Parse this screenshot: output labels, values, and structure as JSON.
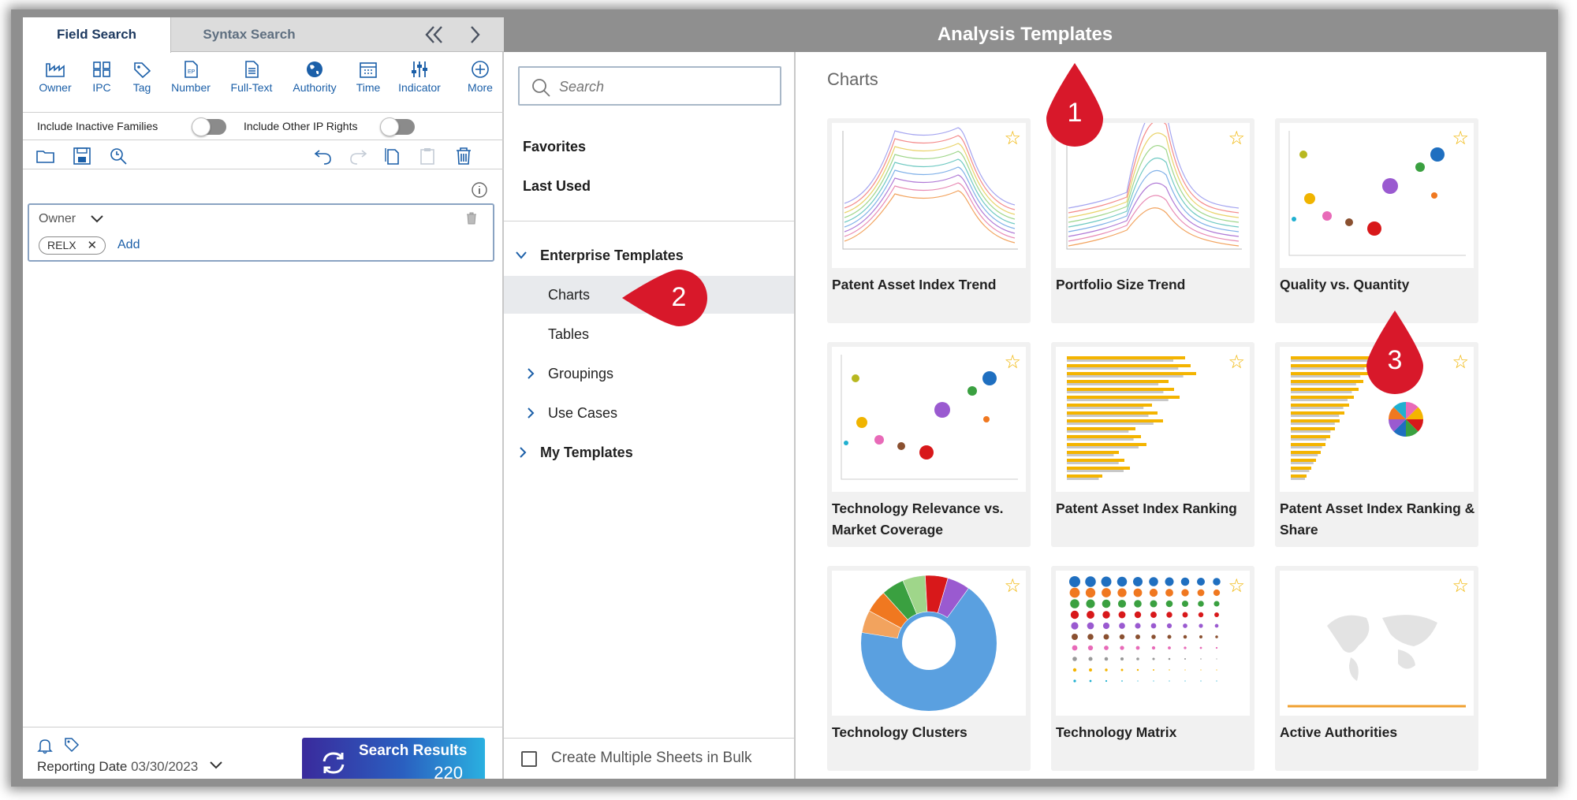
{
  "left": {
    "tabs": {
      "field_search": "Field Search",
      "syntax_search": "Syntax Search"
    },
    "tools": [
      "Owner",
      "IPC",
      "Tag",
      "Number",
      "Full-Text",
      "Authority",
      "Time",
      "Indicator",
      "More"
    ],
    "toggles": {
      "inactive": "Include Inactive Families",
      "other_ip": "Include Other IP Rights"
    },
    "owner_field": {
      "label": "Owner",
      "chip": "RELX",
      "add": "Add"
    },
    "reporting": {
      "label": "Reporting Date",
      "date": "03/30/2023"
    },
    "search_results": {
      "label": "Search Results",
      "count": "220"
    }
  },
  "header": {
    "title": "Analysis Templates"
  },
  "middle": {
    "search_placeholder": "Search",
    "favorites": "Favorites",
    "last_used": "Last Used",
    "enterprise": "Enterprise Templates",
    "charts": "Charts",
    "tables": "Tables",
    "groupings": "Groupings",
    "use_cases": "Use Cases",
    "my_templates": "My Templates",
    "bulk": "Create Multiple Sheets in Bulk"
  },
  "main": {
    "heading": "Charts",
    "cards": [
      {
        "title": "Patent Asset Index Trend",
        "thumb": "line-trend"
      },
      {
        "title": "Portfolio Size Trend",
        "thumb": "line-peak"
      },
      {
        "title": "Quality vs. Quantity",
        "thumb": "bubble"
      },
      {
        "title": "Technology Relevance vs. Market Coverage",
        "thumb": "bubble"
      },
      {
        "title": "Patent Asset Index Ranking",
        "thumb": "hbar"
      },
      {
        "title": "Patent Asset Index Ranking & Share",
        "thumb": "hbar-pie"
      },
      {
        "title": "Technology Clusters",
        "thumb": "sunburst"
      },
      {
        "title": "Technology Matrix",
        "thumb": "dot-matrix"
      },
      {
        "title": "Active Authorities",
        "thumb": "world-map"
      }
    ]
  },
  "callouts": [
    "1",
    "2",
    "3"
  ],
  "colors": {
    "accent": "#1b5fa8",
    "callout": "#d8182a",
    "star": "#f0b400",
    "header_bg": "#8f8f8f"
  }
}
